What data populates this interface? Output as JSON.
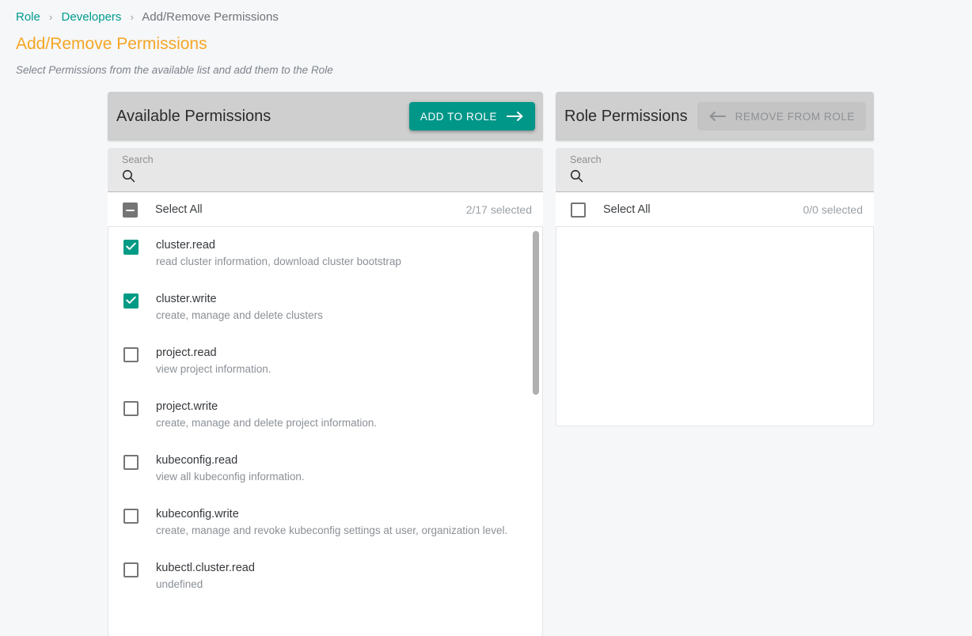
{
  "breadcrumb": {
    "items": [
      {
        "label": "Role",
        "type": "link"
      },
      {
        "label": "Developers",
        "type": "link"
      },
      {
        "label": "Add/Remove Permissions",
        "type": "current"
      }
    ],
    "separator": "›"
  },
  "page": {
    "title": "Add/Remove Permissions",
    "subtitle": "Select Permissions from the available list and add them to the Role",
    "title_color": "#f5a623",
    "link_color": "#009b8e"
  },
  "available_panel": {
    "title": "Available Permissions",
    "action_label": "ADD TO ROLE",
    "action_icon": "arrow-right-icon",
    "action_enabled": true,
    "action_color": "#009688",
    "search": {
      "label": "Search",
      "value": "",
      "placeholder": "",
      "icon": "search-icon"
    },
    "select_all": {
      "label": "Select All",
      "count_text": "2/17 selected",
      "state": "indeterminate"
    },
    "items": [
      {
        "name": "cluster.read",
        "description": "read cluster information, download cluster bootstrap",
        "checked": true
      },
      {
        "name": "cluster.write",
        "description": "create, manage and delete clusters",
        "checked": true
      },
      {
        "name": "project.read",
        "description": "view project information.",
        "checked": false
      },
      {
        "name": "project.write",
        "description": "create, manage and delete project information.",
        "checked": false
      },
      {
        "name": "kubeconfig.read",
        "description": "view all kubeconfig information.",
        "checked": false
      },
      {
        "name": "kubeconfig.write",
        "description": "create, manage and revoke kubeconfig settings at user, organization level.",
        "checked": false
      },
      {
        "name": "kubectl.cluster.read",
        "description": "undefined",
        "checked": false
      }
    ],
    "scrollbar": {
      "thumb_top_pct": 1,
      "thumb_height_pct": 40
    }
  },
  "role_panel": {
    "title": "Role Permissions",
    "action_label": "REMOVE FROM ROLE",
    "action_icon": "arrow-left-icon",
    "action_enabled": false,
    "search": {
      "label": "Search",
      "value": "",
      "placeholder": "",
      "icon": "search-icon"
    },
    "select_all": {
      "label": "Select All",
      "count_text": "0/0 selected",
      "state": "unchecked"
    },
    "items": []
  }
}
